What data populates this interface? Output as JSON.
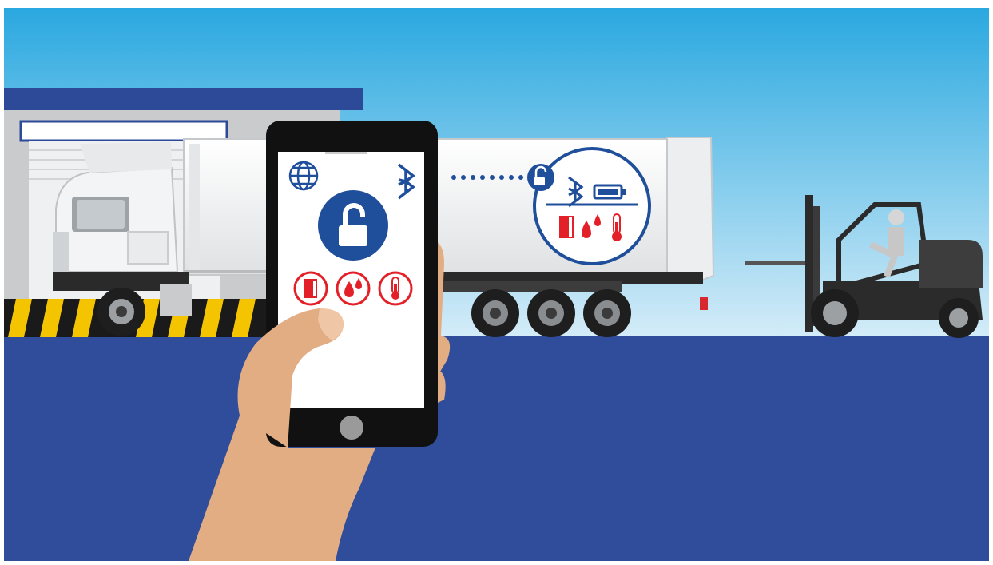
{
  "colors": {
    "sky_top": "#2aa8e0",
    "sky_bottom": "#cde8f6",
    "ground": "#2f4d9b",
    "brand_blue": "#1f4e9b",
    "alert_red": "#e32028",
    "phone_body": "#111111",
    "skin": "#e3ad84",
    "warehouse_gray": "#c9cbcd",
    "hazard_yellow": "#f5c400",
    "trailer_white": "#f1f2f3"
  },
  "scene": {
    "phone": {
      "icons": [
        "globe-icon",
        "bluetooth-icon",
        "unlocked-padlock-icon",
        "door-sensor-icon",
        "humidity-icon",
        "temperature-icon"
      ]
    },
    "trailer_badge": {
      "icons": [
        "unlocked-truck-icon",
        "bluetooth-icon",
        "battery-icon",
        "door-sensor-icon",
        "humidity-icon",
        "temperature-icon"
      ]
    },
    "vehicles": [
      "truck-cab",
      "refrigerated-trailer",
      "forklift"
    ]
  }
}
